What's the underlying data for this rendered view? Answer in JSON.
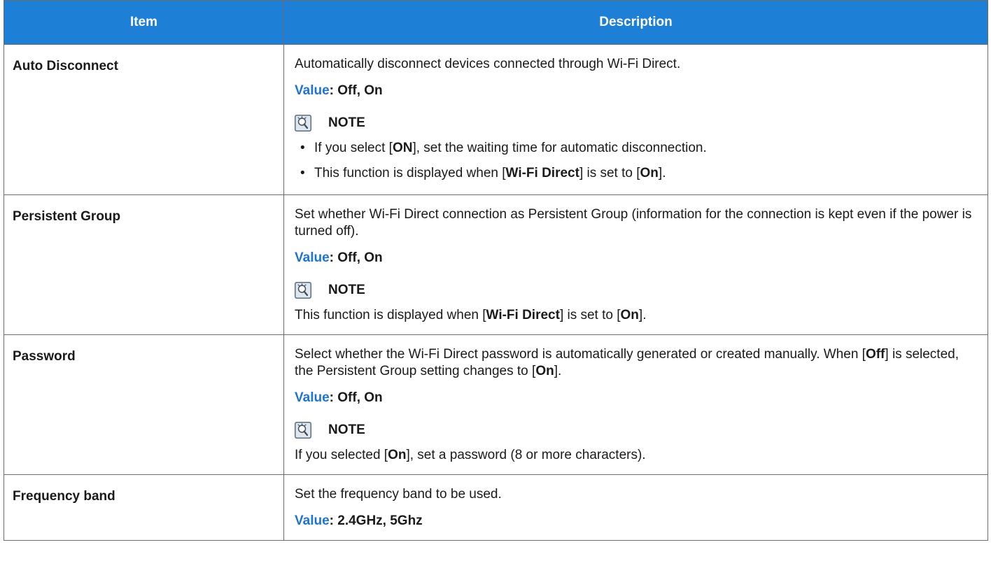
{
  "header": {
    "item": "Item",
    "description": "Description"
  },
  "rows": [
    {
      "item": "Auto Disconnect",
      "desc": [
        "Automatically disconnect devices connected through Wi-Fi Direct."
      ],
      "value_label": "Value",
      "value_text": ": Off, On",
      "note_title": "NOTE",
      "bullets": [
        {
          "a": "If you select [",
          "b": "ON",
          "c": "], set the waiting time for automatic disconnection.",
          "d": "",
          "e": "",
          "f": ""
        },
        {
          "a": "This function is displayed when [",
          "b": "Wi-Fi Direct",
          "c": "] is set to [",
          "d": "On",
          "e": "].",
          "f": ""
        }
      ],
      "bullet_glyph": "•"
    },
    {
      "item": "Persistent Group",
      "desc": [
        "Set whether Wi-Fi Direct connection as Persistent Group (information for the connection is kept even if the power is turned off)."
      ],
      "value_label": "Value",
      "value_text": ": Off, On",
      "note_title": "NOTE",
      "note": {
        "a": "This function is displayed when [",
        "b": "Wi-Fi Direct",
        "c": "] is set to [",
        "d": "On",
        "e": "]."
      }
    },
    {
      "item": "Password",
      "desc": {
        "a": "Select whether the Wi-Fi Direct password is automatically generated or created manually. When [",
        "b": "Off",
        "c": "] is selected, the Persistent Group setting changes to [",
        "d": "On",
        "e": "]."
      },
      "value_label": "Value",
      "value_text": ": Off, On",
      "note_title": "NOTE",
      "note": {
        "a": " If you selected [",
        "b": "On",
        "c": "], set a password (8 or more characters)."
      }
    },
    {
      "item": "Frequency band",
      "desc": [
        "Set the frequency band to be used."
      ],
      "value_label": "Value",
      "value_text": ": 2.4GHz, 5Ghz"
    }
  ],
  "colors": {
    "header_bg": "#1e7fd6",
    "value_label": "#1f73d6",
    "border": "#6b6b6b"
  },
  "icons": {
    "note": "note-lightbulb-icon"
  }
}
